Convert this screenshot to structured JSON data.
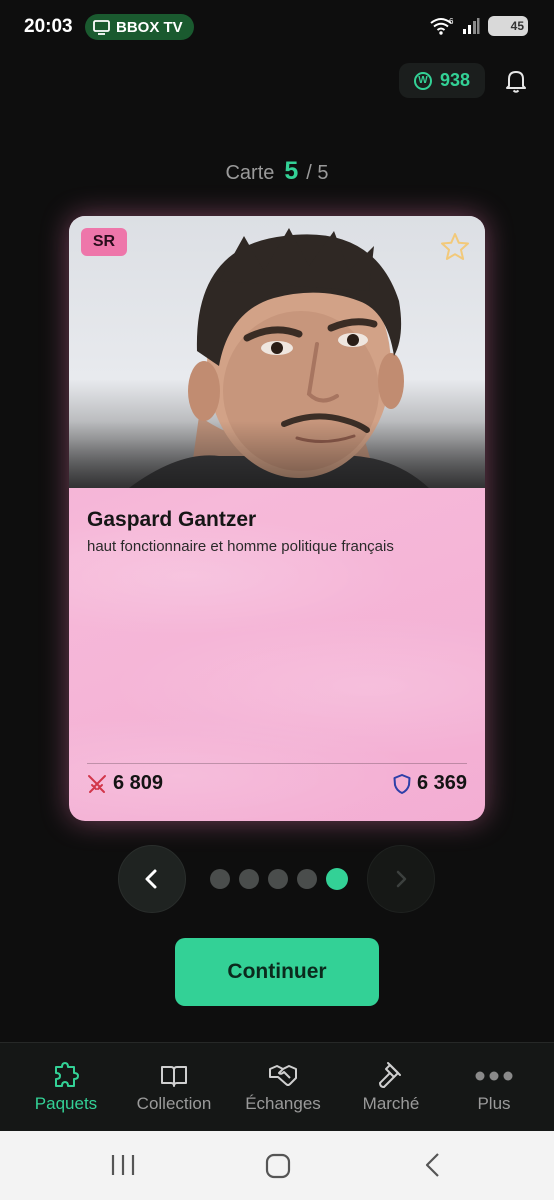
{
  "status_bar": {
    "time": "20:03",
    "cast_label": "BBOX TV",
    "wifi_badge": "6",
    "battery": "45"
  },
  "header": {
    "coins": "938",
    "coin_symbol": "W"
  },
  "counter": {
    "label": "Carte",
    "current": "5",
    "total": "/ 5"
  },
  "card": {
    "rarity": "SR",
    "name": "Gaspard Gantzer",
    "description": "haut fonctionnaire et homme politique français",
    "attack": "6 809",
    "defense": "6 369",
    "rarity_color": "#ee76aa"
  },
  "pager": {
    "count": 5,
    "active_index": 5
  },
  "actions": {
    "continue_label": "Continuer"
  },
  "bottom_nav": {
    "items": [
      {
        "label": "Paquets",
        "icon": "puzzle-icon",
        "active": true
      },
      {
        "label": "Collection",
        "icon": "book-icon",
        "active": false
      },
      {
        "label": "Échanges",
        "icon": "handshake-icon",
        "active": false
      },
      {
        "label": "Marché",
        "icon": "gavel-icon",
        "active": false
      },
      {
        "label": "Plus",
        "icon": "more-dots-icon",
        "active": false
      }
    ]
  },
  "colors": {
    "accent": "#33d196",
    "background": "#0e0e0e",
    "card_pink": "#f3aed3"
  }
}
